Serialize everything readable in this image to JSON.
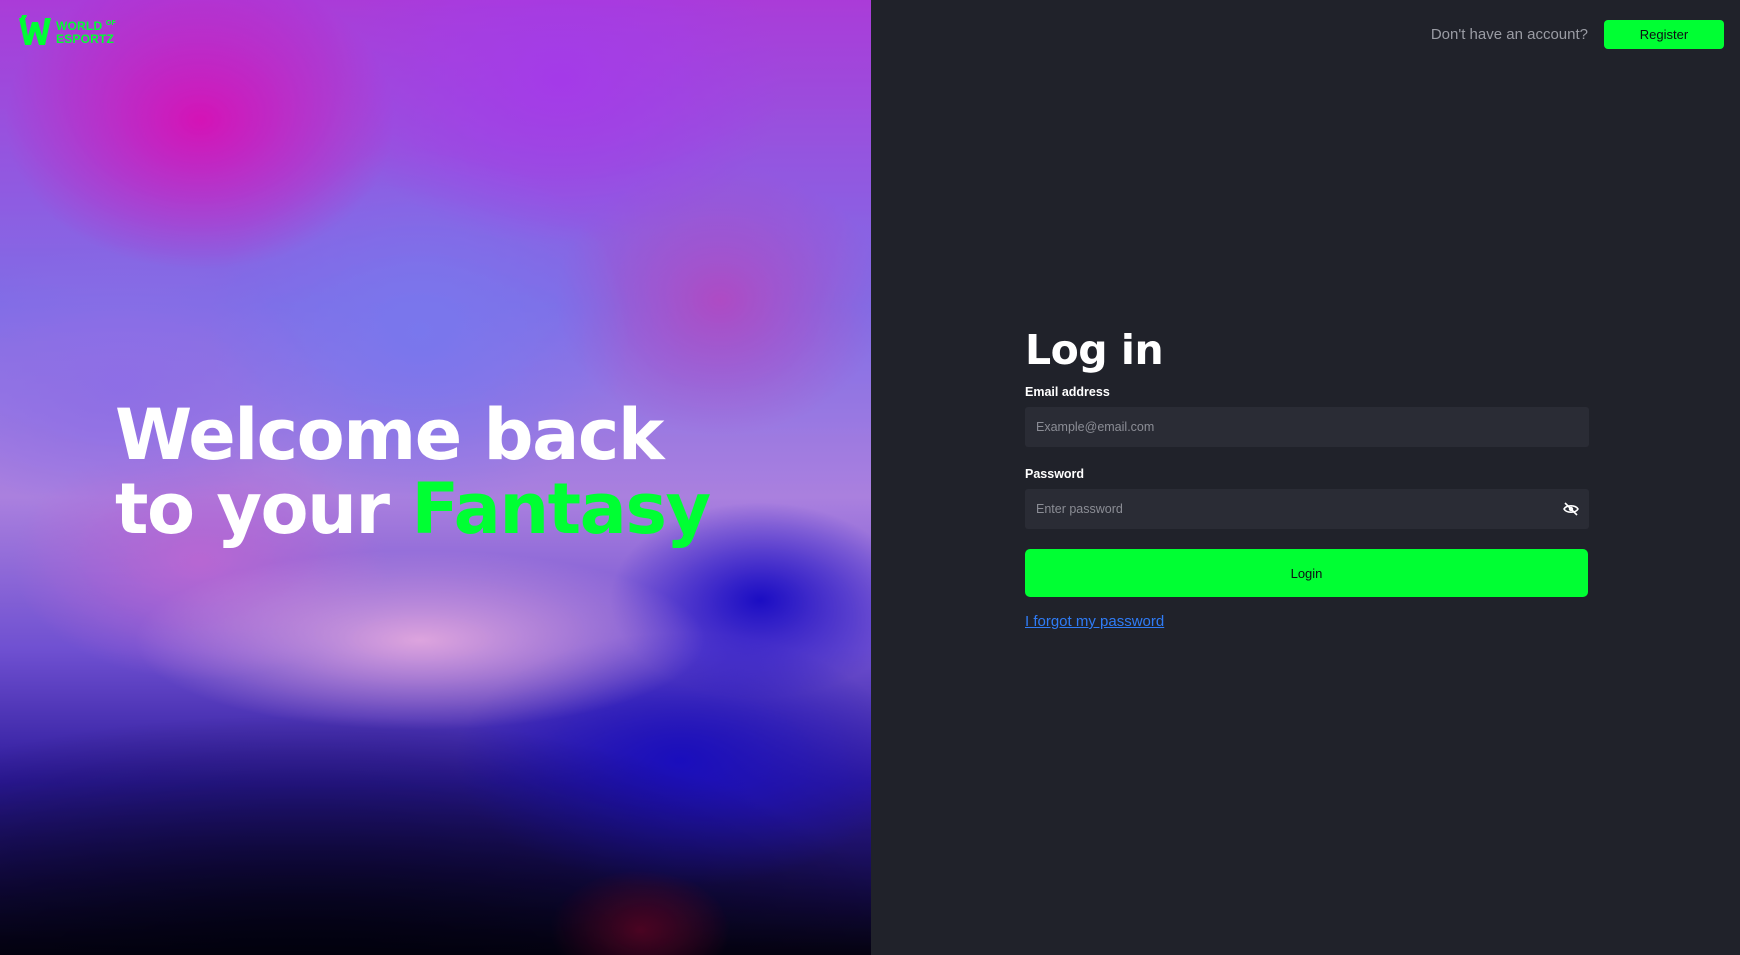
{
  "brand": {
    "logo_line1": "WORLD",
    "logo_of": "OF",
    "logo_line2": "ESPORTZ",
    "accent_color": "#00ff33"
  },
  "hero": {
    "line1": "Welcome back",
    "line2_prefix": "to your",
    "line2_accent": "Fantasy"
  },
  "topbar": {
    "prompt_text": "Don't have an account?",
    "register_label": "Register"
  },
  "login_form": {
    "title": "Log in",
    "email_label": "Email address",
    "email_value": "",
    "email_placeholder": "Example@email.com",
    "password_label": "Password",
    "password_value": "",
    "password_placeholder": "Enter password",
    "password_toggle_icon": "eye-off-icon",
    "submit_label": "Login",
    "forgot_link": "I forgot my password"
  },
  "colors": {
    "background": "#20222a",
    "input_background": "#2a2c35",
    "link": "#2f7cf6"
  }
}
